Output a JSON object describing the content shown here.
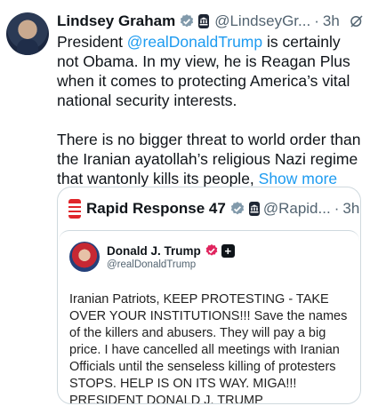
{
  "author": {
    "name": "Lindsey Graham",
    "handle": "@LindseyGr...",
    "separator": "·",
    "time": "3h"
  },
  "body": {
    "line_1_prefix": "President ",
    "mention": "@realDonaldTrump",
    "line_1_suffix": " is certainly not Obama. In my view, he is Reagan Plus when it comes to protecting America’s vital national security interests.",
    "paragraph_2": "There is no bigger threat to world order than the Iranian ayatollah’s religious Nazi regime that wantonly kills its people, ",
    "show_more": "Show more"
  },
  "quote": {
    "name": "Rapid Response 47",
    "handle": "@Rapid...",
    "separator": "·",
    "time": "3h",
    "card": {
      "name": "Donald J. Trump",
      "plus": "+",
      "handle": "@realDonaldTrump",
      "text": "Iranian Patriots, KEEP PROTESTING - TAKE OVER YOUR INSTITUTIONS!!! Save the names of the killers and abusers. They will pay a big price. I have cancelled all meetings with Iranian Officials until the senseless killing of protesters STOPS. HELP IS ON ITS WAY. MIGA!!! PRESIDENT DONALD J. TRUMP"
    }
  },
  "icons": {
    "verified": "verified-check-icon",
    "gov": "government-badge-icon",
    "grok": "grok-icon",
    "rr_logo": "rapid-response-logo",
    "pink_verified": "pink-verified-icon"
  },
  "colors": {
    "link": "#1d9bf0",
    "verified": "#829aab",
    "pink_badge": "#e0245e",
    "rr_red": "#e0262b",
    "muted": "#536471"
  }
}
